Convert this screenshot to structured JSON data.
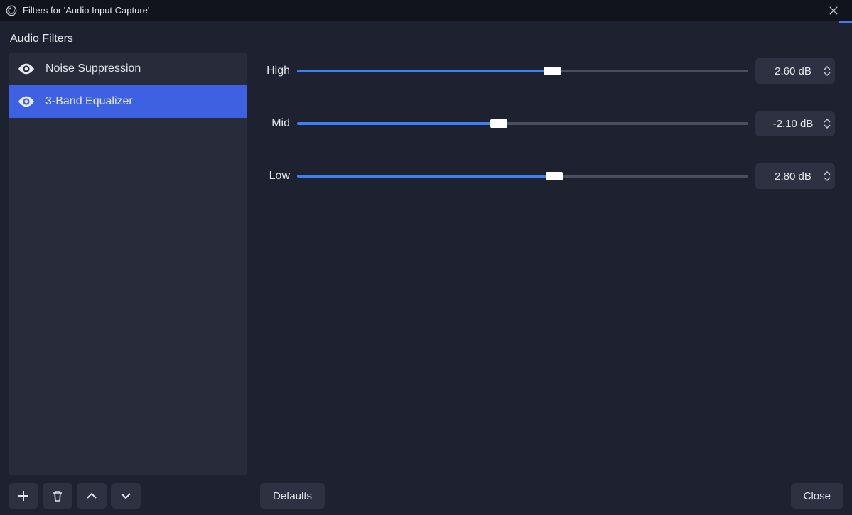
{
  "window": {
    "title": "Filters for 'Audio Input Capture'"
  },
  "section_label": "Audio Filters",
  "filters": [
    {
      "name": "Noise Suppression",
      "selected": false
    },
    {
      "name": "3-Band Equalizer",
      "selected": true
    }
  ],
  "equalizer": {
    "slider_min": -20.0,
    "slider_max": 20.0,
    "bands": [
      {
        "label": "High",
        "value": 2.6,
        "display": "2.60 dB"
      },
      {
        "label": "Mid",
        "value": -2.1,
        "display": "-2.10 dB"
      },
      {
        "label": "Low",
        "value": 2.8,
        "display": "2.80 dB"
      }
    ]
  },
  "buttons": {
    "defaults": "Defaults",
    "close": "Close"
  }
}
